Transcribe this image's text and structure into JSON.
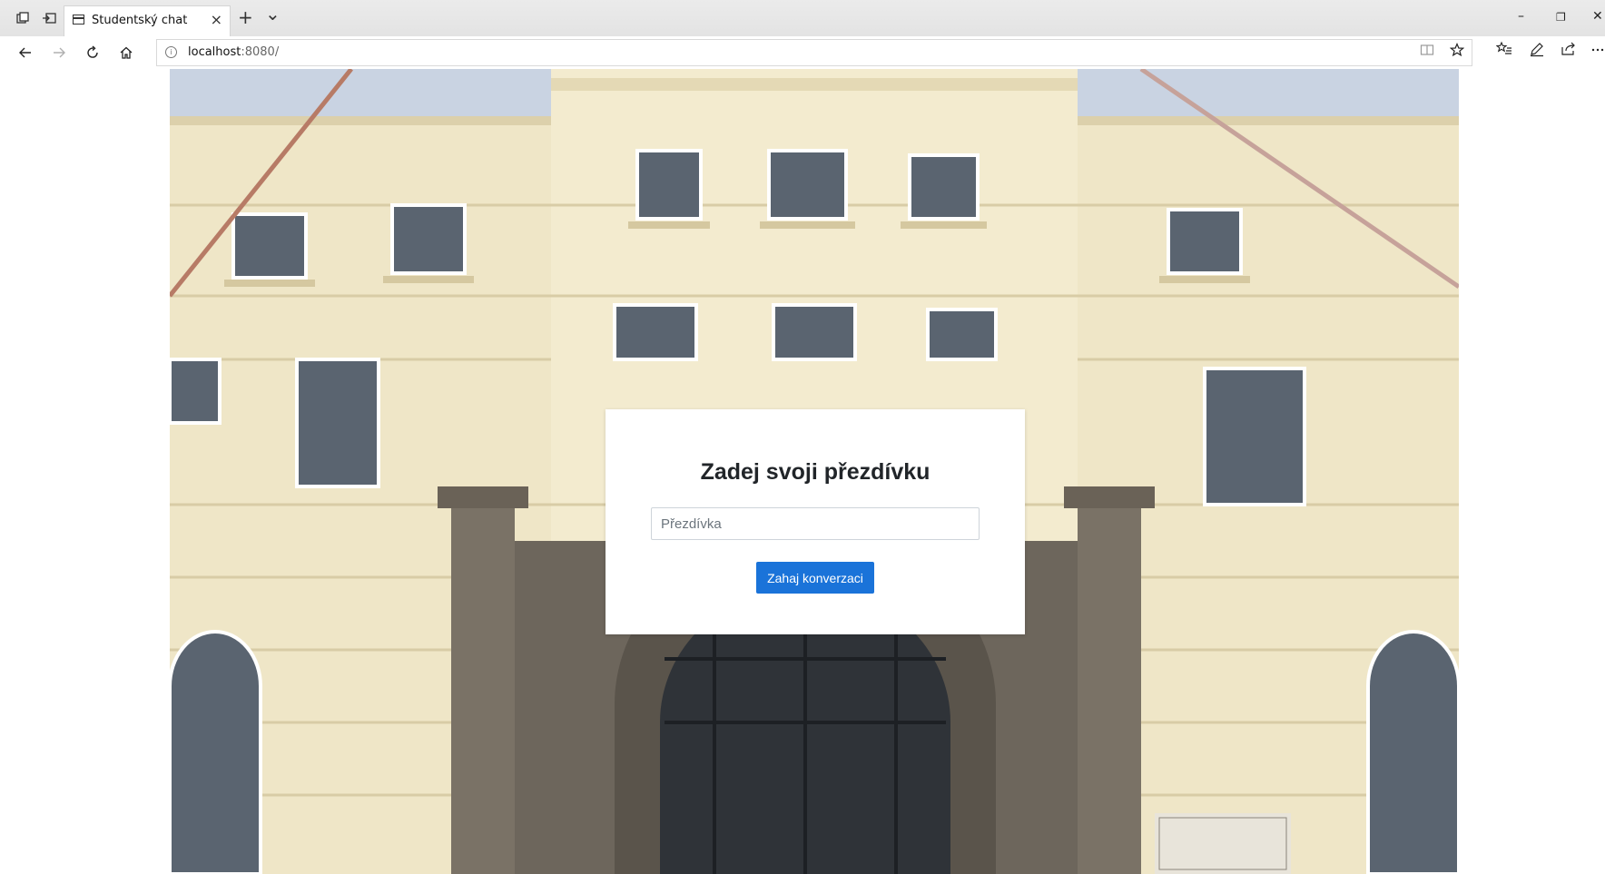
{
  "browser": {
    "tab": {
      "title": "Studentský chat",
      "close_glyph": "×"
    },
    "new_tab_glyph": "+",
    "tab_list_glyph": "⌄",
    "window_controls": {
      "minimize": "–",
      "restore": "❐",
      "close": "✕"
    },
    "address": {
      "host": "localhost",
      "port_path": ":8080/"
    },
    "icons": {
      "tab_aside": "tab-aside-icon",
      "tab_restore": "tab-restore-icon",
      "back": "arrow-left-icon",
      "forward": "arrow-right-icon",
      "refresh": "refresh-icon",
      "home": "home-icon",
      "site_info": "info-icon",
      "reading_view": "reading-view-icon",
      "favorite": "star-icon",
      "favorites_hub": "favorites-icon",
      "notes": "pen-icon",
      "share": "share-icon",
      "more": "more-icon"
    }
  },
  "login": {
    "title": "Zadej svoji přezdívku",
    "nickname_placeholder": "Přezdívka",
    "nickname_value": "",
    "submit_label": "Zahaj konverzaci"
  },
  "colors": {
    "primary_button": "#1a73d9",
    "card_background": "#ffffff",
    "title_text": "#212529"
  }
}
